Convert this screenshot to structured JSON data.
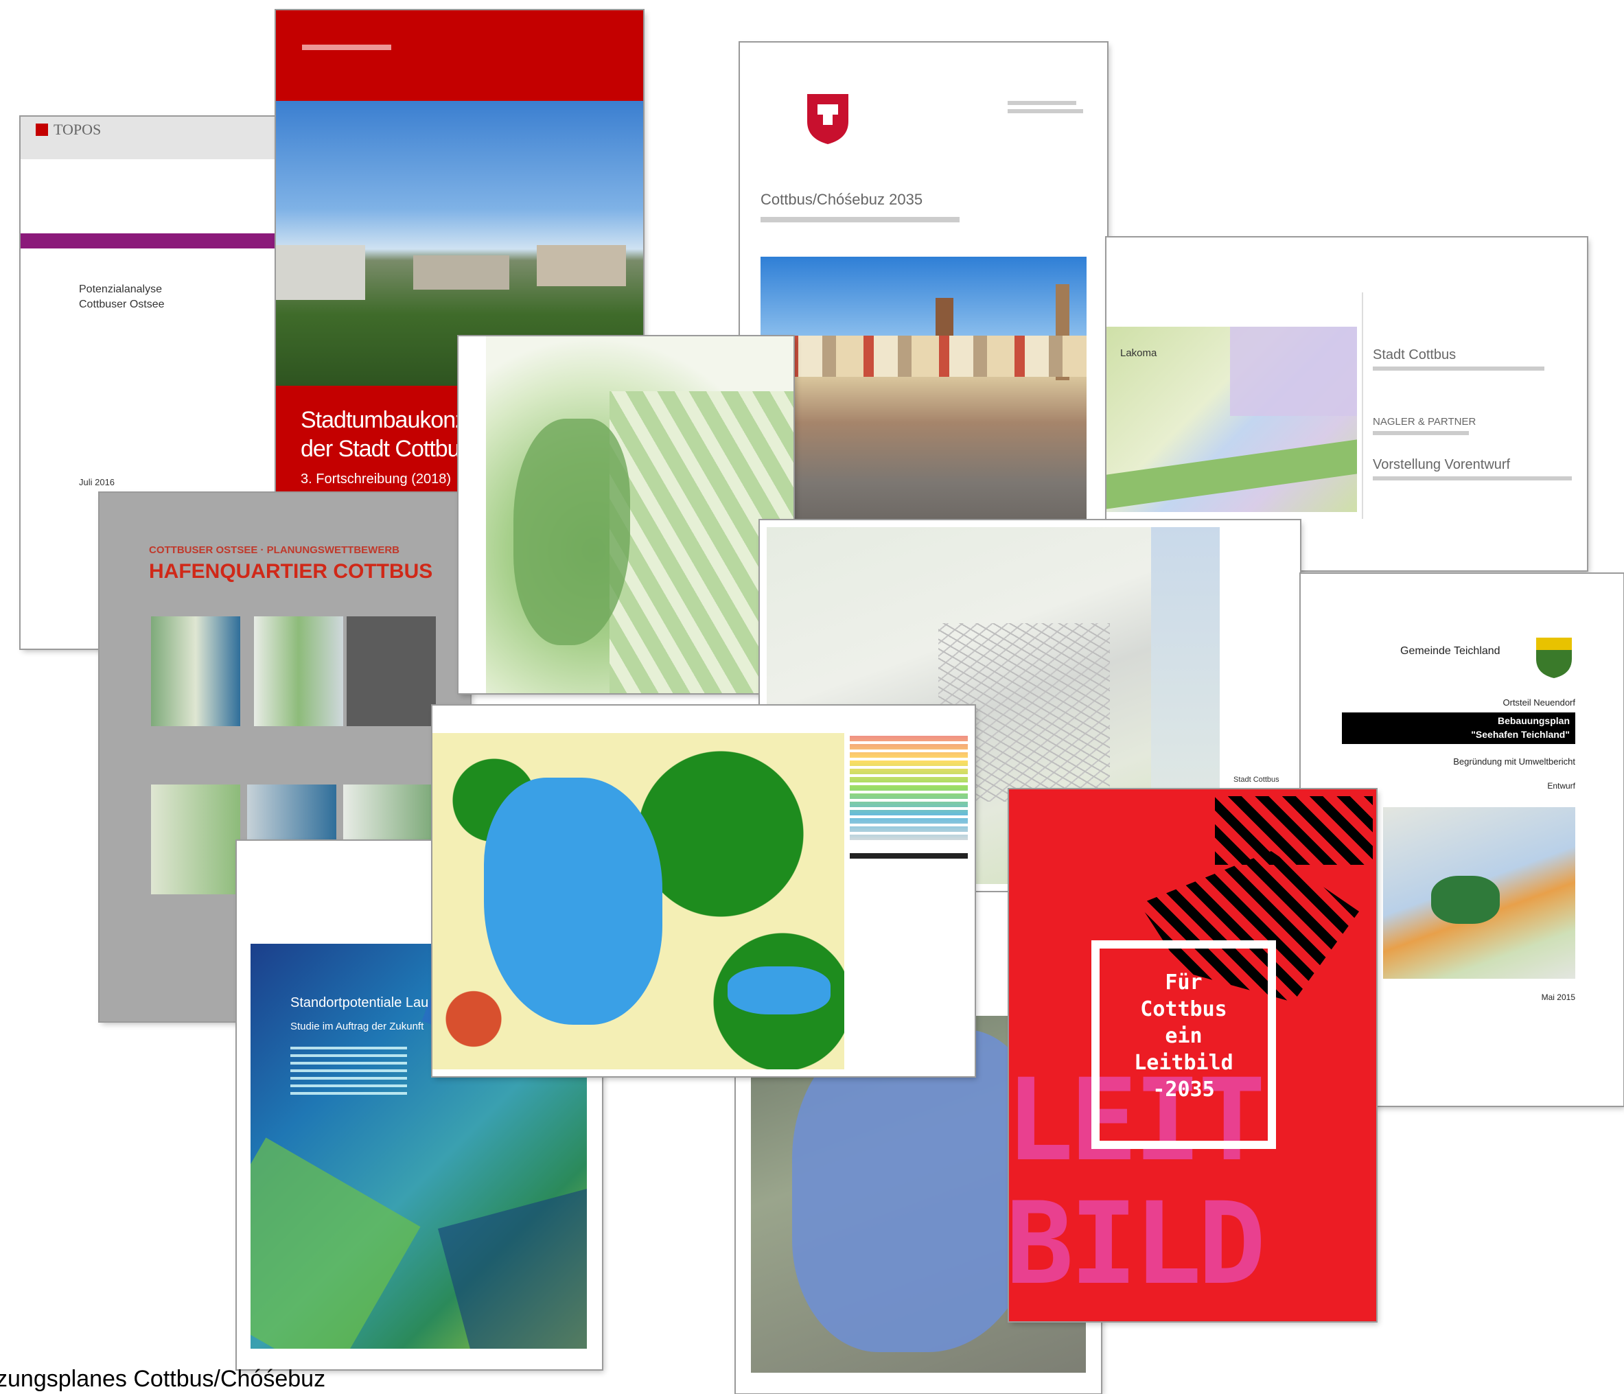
{
  "topos": {
    "logo": "TOPOS",
    "title_line1": "Potenzialanalyse",
    "title_line2": "Cottbuser Ostsee",
    "date": "Juli 2016"
  },
  "stadtumbau": {
    "title_line1": "Stadtumbaukonze",
    "title_line2": "der Stadt Cottbus",
    "subtitle": "3. Fortschreibung (2018)"
  },
  "insek": {
    "title": "Cottbus/Chóśebuz 2035"
  },
  "lakoma": {
    "label": "Lakoma",
    "line1": "Stadt Cottbus",
    "line2": "NAGLER & PARTNER",
    "line3": "Vorstellung Vorentwurf"
  },
  "hafen": {
    "kicker": "COTTBUSER OSTSEE · PLANUNGSWETTBEWERB",
    "title": "HAFENQUARTIER COTTBUS"
  },
  "standort": {
    "title": "Standortpotentiale Lau",
    "subtitle": "Studie im Auftrag der Zukunft"
  },
  "teichland": {
    "municipality": "Gemeinde Teichland",
    "district": "Ortsteil Neuendorf",
    "plan_line1": "Bebauungsplan",
    "plan_line2": "\"Seehafen Teichland\"",
    "justification": "Begründung mit Umweltbericht",
    "draft": "Entwurf",
    "date": "Mai 2015"
  },
  "leitbild": {
    "box_line1": "Für",
    "box_line2": "Cottbus",
    "box_line3": "ein",
    "box_line4": "Leitbild",
    "box_line5": "-2035",
    "big1": "LEIT",
    "big2": "BILD"
  },
  "stadt_map": {
    "label": "Stadt Cottbus"
  },
  "caption": "zungsplanes Cottbus/Chóśebuz",
  "colors": {
    "red": "#c40000",
    "leitbild_red": "#ec1c24",
    "leitbild_pink": "#e9408f",
    "lake_blue": "#3aa0e6",
    "forest_green": "#1e8c1e",
    "purple_band": "#8b1a7a"
  }
}
